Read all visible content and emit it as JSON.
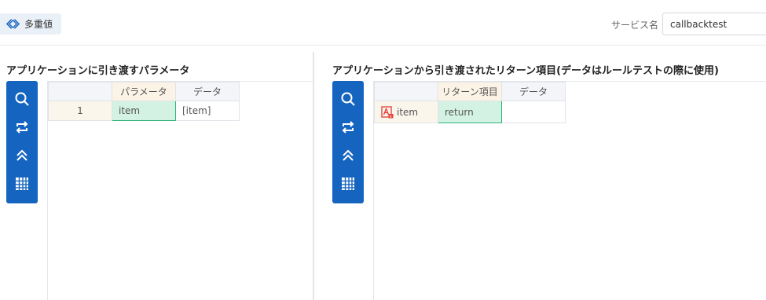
{
  "top": {
    "multi_value_label": "多重値",
    "service_name_label": "サービス名",
    "service_name_value": "callbacktest"
  },
  "left_panel": {
    "title": "アプリケーションに引き渡すパラメータ",
    "columns": [
      "",
      "パラメータ",
      "データ"
    ],
    "rows": [
      {
        "index": "1",
        "parameter": "item",
        "data": "[item]"
      }
    ]
  },
  "right_panel": {
    "title": "アプリケーションから引き渡されたリターン項目(データはルールテストの際に使用)",
    "columns": [
      "",
      "リターン項目",
      "データ"
    ],
    "rows": [
      {
        "item": "item",
        "return_item": "return",
        "data": ""
      }
    ]
  },
  "toolbar_icons": [
    "search-icon",
    "swap-icon",
    "collapse-up-icon",
    "grid-add-icon"
  ],
  "colors": {
    "toolbar_bg": "#1565c0",
    "selected_cell_bg": "#d3f2e3",
    "selected_cell_border": "#2fb47a",
    "header_highlight": "#fbf3e6"
  }
}
